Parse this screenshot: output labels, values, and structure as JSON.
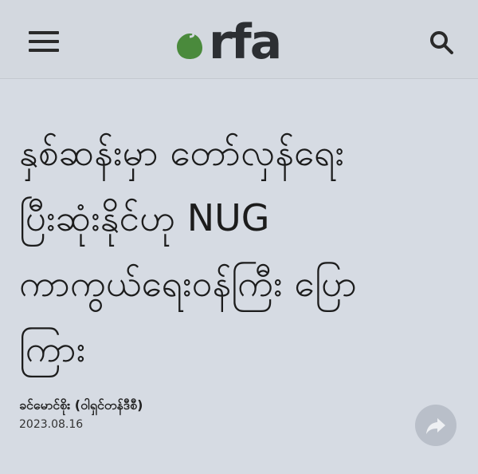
{
  "header": {
    "logo_text": "rfa",
    "logo_dot_color": "#4a8a3c",
    "menu_icon": "hamburger-menu-icon",
    "search_icon": "search-icon"
  },
  "article": {
    "headline_lines": [
      "နှစ်ဆန်းမှာ တော်လှန်ရေး",
      "ပြီးဆုံးနိုင်ဟု NUG",
      "ကာကွယ်ရေးဝန်ကြီး ပြော",
      "ကြား"
    ],
    "author": "ခင်မောင်စိုး (ဝါရှင်တန်ဒီစီ)",
    "date": "2023.08.16",
    "share_icon": "share-arrow-icon"
  }
}
